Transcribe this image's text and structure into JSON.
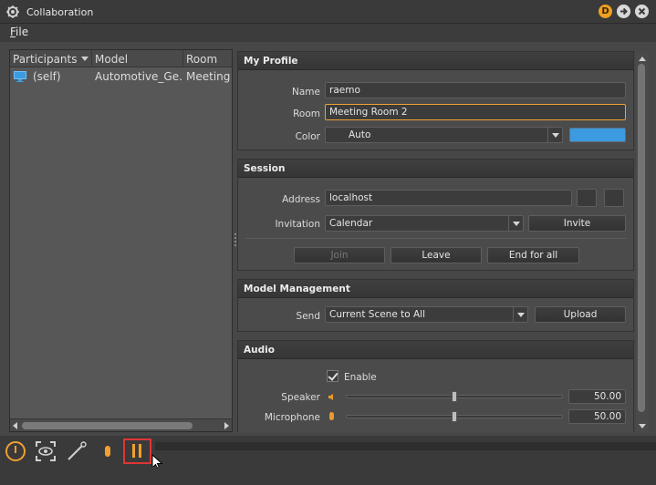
{
  "window": {
    "title": "Collaboration",
    "titlebar_buttons": [
      "D"
    ]
  },
  "menu": {
    "file_label": "File"
  },
  "participants_table": {
    "columns": [
      "Participants",
      "Model",
      "Room"
    ],
    "rows": [
      {
        "participant": "(self)",
        "model": "Automotive_Ge...",
        "room": "Meeting R"
      }
    ]
  },
  "my_profile": {
    "header": "My Profile",
    "name_label": "Name",
    "name_value": "raemo",
    "room_label": "Room",
    "room_value": "Meeting Room 2",
    "color_label": "Color",
    "color_value": "Auto",
    "swatch_color": "#3c9ae0"
  },
  "session": {
    "header": "Session",
    "address_label": "Address",
    "address_value": "localhost",
    "invitation_label": "Invitation",
    "invitation_value": "Calendar",
    "invite_button": "Invite",
    "join_button": "Join",
    "leave_button": "Leave",
    "end_button": "End for all"
  },
  "model_management": {
    "header": "Model Management",
    "send_label": "Send",
    "send_value": "Current Scene to All",
    "upload_button": "Upload"
  },
  "audio": {
    "header": "Audio",
    "enable_label": "Enable",
    "enable_checked": true,
    "speaker_label": "Speaker",
    "speaker_value": "50.00",
    "speaker_level": 0.5,
    "microphone_label": "Microphone",
    "microphone_value": "50.00",
    "microphone_level": 0.5
  },
  "colors": {
    "accent": "#f0a030",
    "highlight": "#e03535"
  },
  "toolbar": {
    "icons": [
      "power-icon",
      "eye-frame-icon",
      "wand-icon",
      "mic-icon",
      "pause-icon"
    ]
  }
}
